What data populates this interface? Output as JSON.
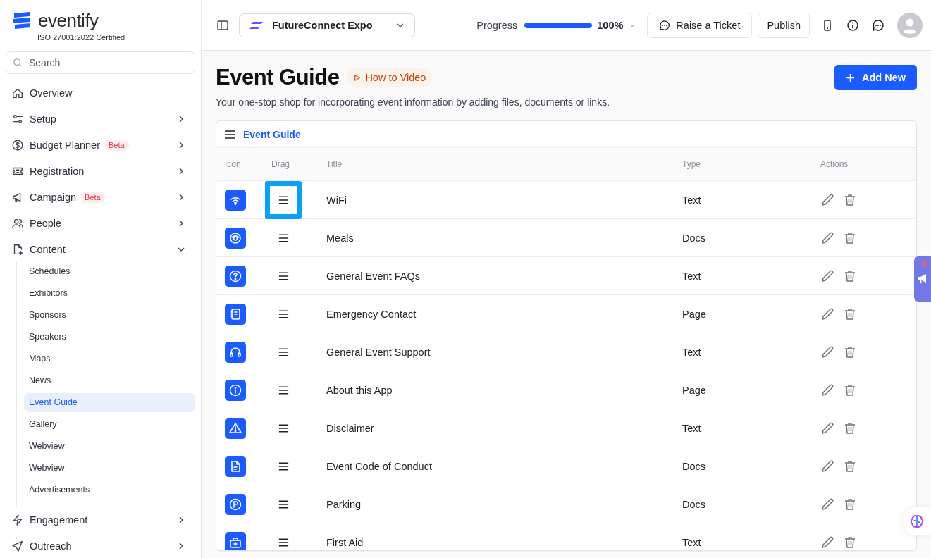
{
  "sidebar": {
    "brand": "eventify",
    "certification": "ISO 27001:2022 Certified",
    "search": {
      "placeholder": "Search"
    },
    "items": [
      {
        "label": "Overview",
        "kind": "home"
      },
      {
        "label": "Setup",
        "kind": "sliders",
        "expanded": false
      },
      {
        "label": "Budget Planner",
        "kind": "dollar",
        "badge": "Beta",
        "expanded": false
      },
      {
        "label": "Registration",
        "kind": "ticket",
        "expanded": false
      },
      {
        "label": "Campaign",
        "kind": "megaphone",
        "badge": "Beta",
        "expanded": false
      },
      {
        "label": "People",
        "kind": "people",
        "expanded": false
      },
      {
        "label": "Content",
        "kind": "file",
        "expanded": true,
        "children": [
          {
            "label": "Schedules",
            "selected": false
          },
          {
            "label": "Exhibitors",
            "selected": false
          },
          {
            "label": "Sponsors",
            "selected": false
          },
          {
            "label": "Speakers",
            "selected": false
          },
          {
            "label": "Maps",
            "selected": false
          },
          {
            "label": "News",
            "selected": false
          },
          {
            "label": "Event Guide",
            "selected": true
          },
          {
            "label": "Gallery",
            "selected": false
          },
          {
            "label": "Webview",
            "selected": false
          },
          {
            "label": "Webview",
            "selected": false
          },
          {
            "label": "Advertisements",
            "selected": false
          }
        ]
      },
      {
        "label": "Engagement",
        "kind": "bolt",
        "expanded": false
      },
      {
        "label": "Outreach",
        "kind": "send",
        "expanded": false
      }
    ]
  },
  "topbar": {
    "event": "FutureConnect Expo",
    "progress_label": "Progress",
    "progress": {
      "level": 1.0
    },
    "progress_reading": "100%",
    "ticket_button": "Raise a Ticket",
    "publish_button": "Publish"
  },
  "page": {
    "title": "Event Guide",
    "video_link": "How to Video",
    "subtitle": "Your one-stop shop for incorporating event information by adding files, documents or links.",
    "add_button": "Add New"
  },
  "table": {
    "title": "Event Guide",
    "columns": [
      "Icon",
      "Drag",
      "Title",
      "Type",
      "Actions"
    ],
    "rows": [
      {
        "kind": "wifi",
        "title": "WiFi",
        "type": "Text",
        "focused": true
      },
      {
        "kind": "meals",
        "title": "Meals",
        "type": "Docs",
        "focused": false
      },
      {
        "kind": "question",
        "title": "General Event FAQs",
        "type": "Text",
        "focused": false
      },
      {
        "kind": "contact",
        "title": "Emergency Contact",
        "type": "Page",
        "focused": false
      },
      {
        "kind": "headset",
        "title": "General Event Support",
        "type": "Text",
        "focused": false
      },
      {
        "kind": "info",
        "title": "About this App",
        "type": "Page",
        "focused": false
      },
      {
        "kind": "warning",
        "title": "Disclaimer",
        "type": "Text",
        "focused": false
      },
      {
        "kind": "document",
        "title": "Event Code of Conduct",
        "type": "Docs",
        "focused": false
      },
      {
        "kind": "parking",
        "title": "Parking",
        "type": "Docs",
        "focused": false
      },
      {
        "kind": "firstaid",
        "title": "First Aid",
        "type": "Text",
        "focused": false
      }
    ]
  }
}
